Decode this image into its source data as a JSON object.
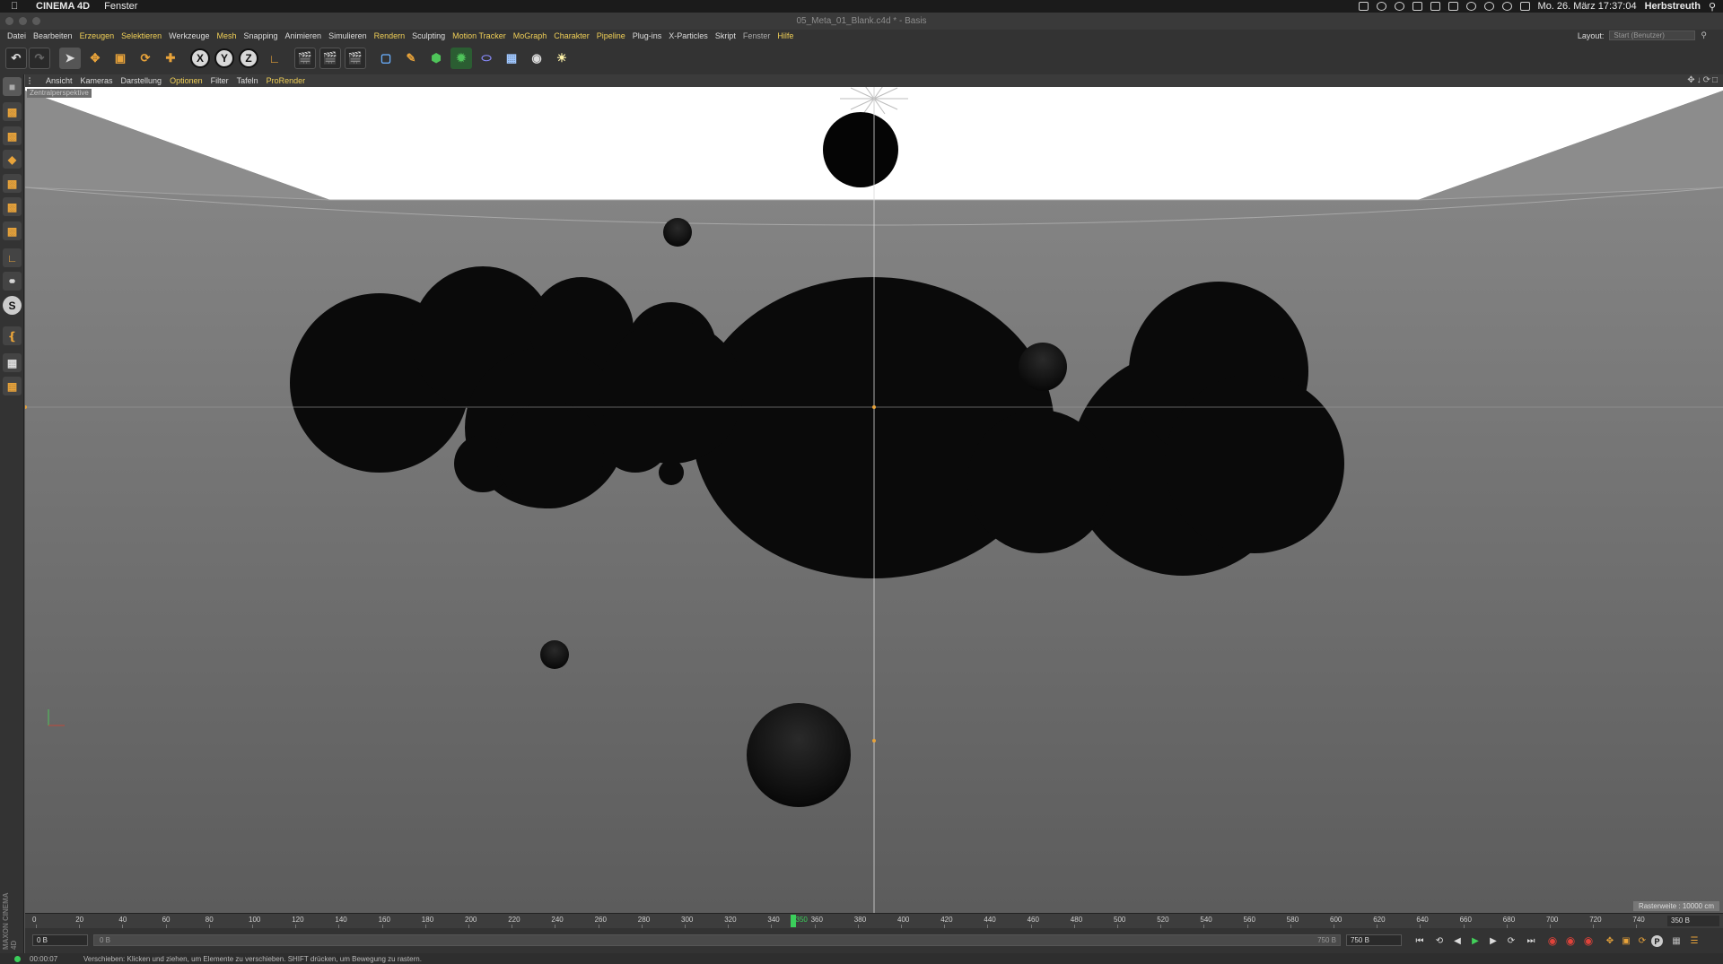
{
  "menubar": {
    "app_name": "CINEMA 4D",
    "window_menu": "Fenster",
    "date_time": "Mo. 26. März  17:37:04",
    "user": "Herbstreuth"
  },
  "window": {
    "title": "05_Meta_01_Blank.c4d * - Basis"
  },
  "app_menu": {
    "items": [
      "Datei",
      "Bearbeiten",
      "Erzeugen",
      "Selektieren",
      "Werkzeuge",
      "Mesh",
      "Snapping",
      "Animieren",
      "Simulieren",
      "Rendern",
      "Sculpting",
      "Motion Tracker",
      "MoGraph",
      "Charakter",
      "Pipeline",
      "Plug-ins",
      "X-Particles",
      "Skript",
      "Fenster",
      "Hilfe"
    ],
    "layout_label": "Layout:",
    "layout_value": "Start (Benutzer)"
  },
  "viewport_menu": {
    "items": [
      "Ansicht",
      "Kameras",
      "Darstellung",
      "Optionen",
      "Filter",
      "Tafeln",
      "ProRender"
    ]
  },
  "viewport": {
    "camera_label": "Zentralperspektive",
    "raster_info": "Rasterweite : 10000 cm"
  },
  "timeline": {
    "ticks": [
      "0",
      "20",
      "40",
      "60",
      "80",
      "100",
      "120",
      "140",
      "160",
      "180",
      "200",
      "220",
      "240",
      "260",
      "280",
      "300",
      "320",
      "340",
      "360",
      "380",
      "400",
      "420",
      "440",
      "460",
      "480",
      "500",
      "520",
      "540",
      "560",
      "580",
      "600",
      "620",
      "640",
      "660",
      "680",
      "700",
      "720",
      "740"
    ],
    "current_frame_label": "350",
    "current_frame": 350,
    "end_frame": "350 B",
    "start_field": "0 B",
    "range_start": "0 B",
    "range_end": "750 B",
    "max_field": "750 B"
  },
  "status": {
    "time": "00:00:07",
    "message": "Verschieben: Klicken und ziehen, um Elemente zu verschieben. SHIFT drücken, um Bewegung zu rastern."
  },
  "brand": {
    "logo_text": "MAXON CINEMA 4D"
  },
  "colors": {
    "accent": "#f0cf57",
    "tool_orange": "#e8a33a",
    "play_green": "#3bcf5b"
  }
}
